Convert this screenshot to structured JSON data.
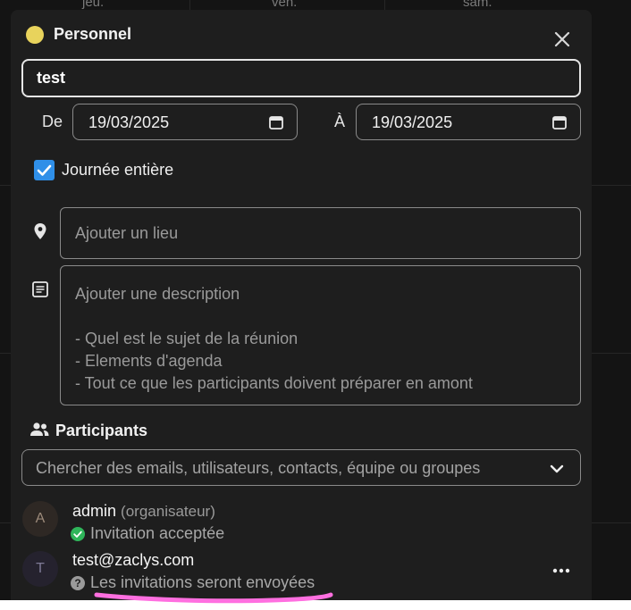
{
  "background": {
    "day_headers": [
      "jeu.",
      "ven.",
      "sam."
    ]
  },
  "event": {
    "calendar_name": "Personnel",
    "calendar_color": "#e8d35c",
    "title": "test",
    "from_label": "De",
    "from_date": "19/03/2025",
    "to_label": "À",
    "to_date": "19/03/2025",
    "all_day_label": "Journée entière",
    "all_day_checked": true,
    "location_placeholder": "Ajouter un lieu",
    "description_placeholder_lines": [
      "Ajouter une description",
      "",
      "- Quel est le sujet de la réunion",
      "- Elements d'agenda",
      "- Tout ce que les participants doivent préparer en amont"
    ]
  },
  "participants": {
    "section_title": "Participants",
    "search_placeholder": "Chercher des emails, utilisateurs, contacts, équipe ou groupes",
    "list": [
      {
        "initial": "A",
        "name": "admin",
        "role": "(organisateur)",
        "status": "Invitation acceptée",
        "status_type": "accepted"
      },
      {
        "initial": "T",
        "name": "test@zaclys.com",
        "role": "",
        "status": "Les invitations seront envoyées",
        "status_type": "pending"
      }
    ]
  },
  "icons": {
    "close": "close-icon",
    "calendar": "calendar-icon",
    "location": "location-pin-icon",
    "description": "notes-icon",
    "participants": "people-icon",
    "dropdown": "chevron-down-icon",
    "more": "more-horizontal-icon"
  },
  "colors": {
    "accent": "#2f8fe8",
    "accepted": "#2fb55a",
    "highlight": "#ff6fe0"
  }
}
